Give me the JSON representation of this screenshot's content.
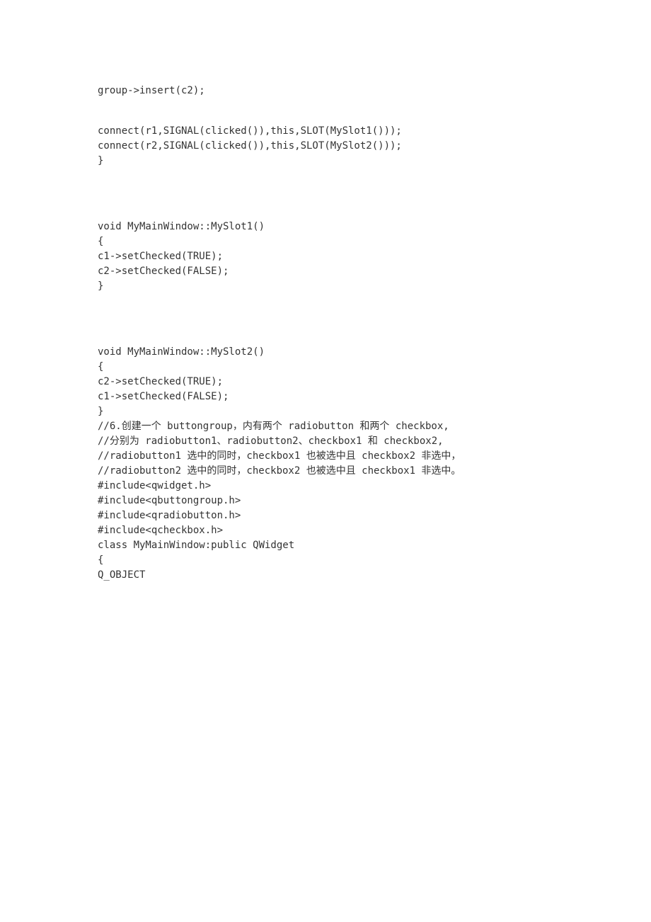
{
  "lines": [
    "group->insert(c2);",
    "",
    "connect(r1,SIGNAL(clicked()),this,SLOT(MySlot1()));",
    "connect(r2,SIGNAL(clicked()),this,SLOT(MySlot2()));",
    "}",
    "",
    "",
    "void MyMainWindow::MySlot1()",
    "{",
    "c1->setChecked(TRUE);",
    "c2->setChecked(FALSE);",
    "}",
    "",
    "",
    "void MyMainWindow::MySlot2()",
    "{",
    "c2->setChecked(TRUE);",
    "c1->setChecked(FALSE);",
    "}",
    "//6.创建一个 buttongroup，内有两个 radiobutton 和两个 checkbox,",
    "//分别为 radiobutton1、radiobutton2、checkbox1 和 checkbox2,",
    "//radiobutton1 选中的同时，checkbox1 也被选中且 checkbox2 非选中，",
    "//radiobutton2 选中的同时，checkbox2 也被选中且 checkbox1 非选中。",
    "#include<qwidget.h>",
    "#include<qbuttongroup.h>",
    "#include<qradiobutton.h>",
    "#include<qcheckbox.h>",
    "class MyMainWindow:public QWidget",
    "{",
    "Q_OBJECT"
  ]
}
